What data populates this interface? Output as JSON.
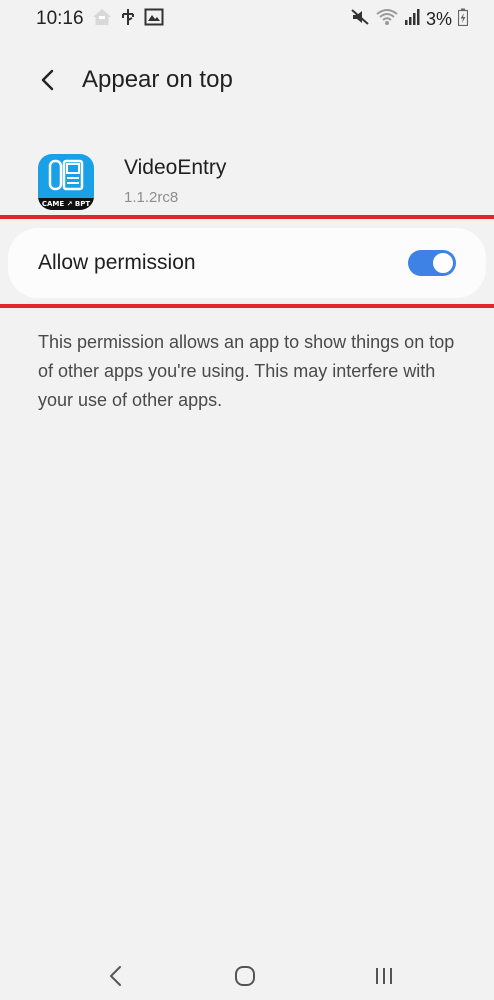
{
  "status_bar": {
    "time": "10:16",
    "battery": "3%",
    "icons": [
      "home-notification-icon",
      "usb-debug-icon",
      "gallery-notification-icon",
      "mute-icon",
      "wifi-icon",
      "signal-icon",
      "battery-charging-icon"
    ]
  },
  "header": {
    "title": "Appear on top",
    "back_icon": "chevron-left-icon"
  },
  "app": {
    "name": "VideoEntry",
    "version": "1.1.2rc8",
    "icon_band_text": "CAME ↗ BPT"
  },
  "permission": {
    "label": "Allow permission",
    "enabled": true
  },
  "description": "This permission allows an app to show things on top of other apps you're using. This may interfere with your use of other apps.",
  "colors": {
    "background": "#f2f2f2",
    "card": "#fcfcfc",
    "accent": "#3e82e6",
    "highlight": "#e3262d",
    "app_icon": "#1aa0e6"
  },
  "nav_bar": {
    "icons": [
      "back-nav-icon",
      "home-nav-icon",
      "recents-nav-icon"
    ]
  }
}
